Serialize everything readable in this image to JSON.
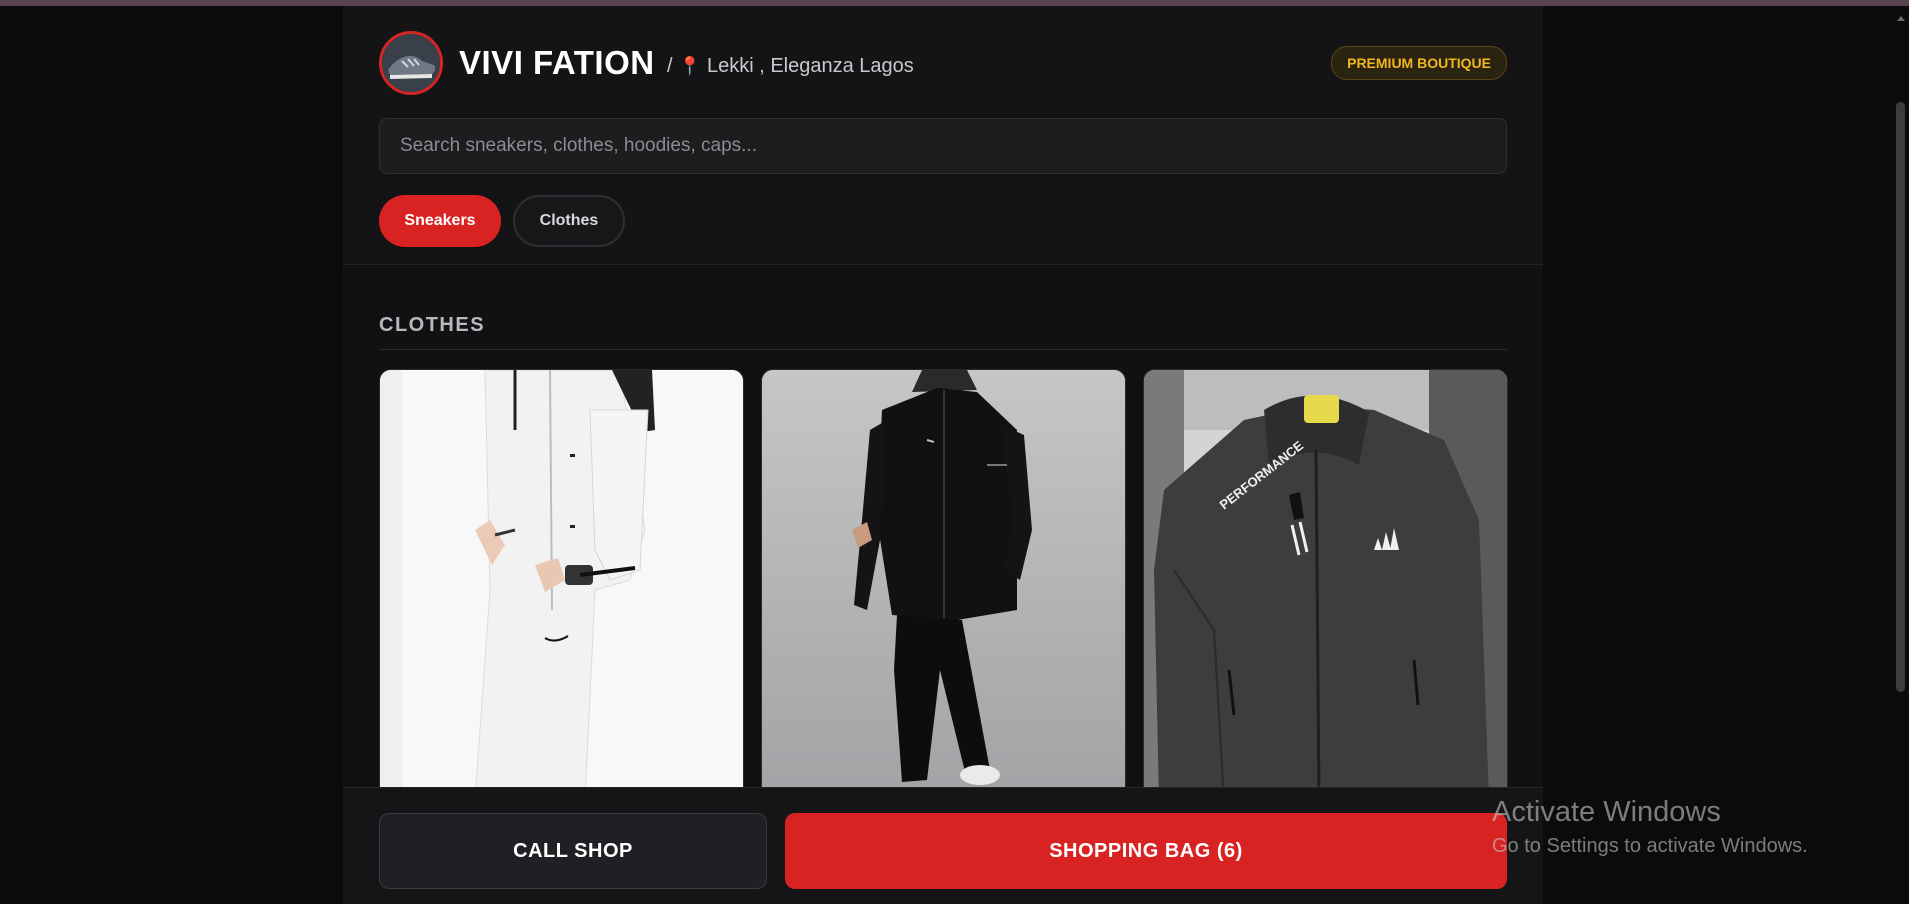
{
  "header": {
    "brand": "VIVI FATION",
    "separator": "/",
    "location": "Lekki , Eleganza Lagos",
    "badge": "PREMIUM BOUTIQUE"
  },
  "search": {
    "placeholder": "Search sneakers, clothes, hoodies, caps..."
  },
  "tabs": [
    {
      "label": "Sneakers",
      "active": true
    },
    {
      "label": "Clothes",
      "active": false
    }
  ],
  "section": {
    "title": "CLOTHES"
  },
  "footer": {
    "call_label": "CALL SHOP",
    "bag_label": "SHOPPING BAG (6)"
  },
  "watermark": {
    "title": "Activate Windows",
    "subtitle": "Go to Settings to activate Windows."
  },
  "colors": {
    "accent": "#d92323",
    "badge": "#f2b522",
    "background": "#111113"
  }
}
